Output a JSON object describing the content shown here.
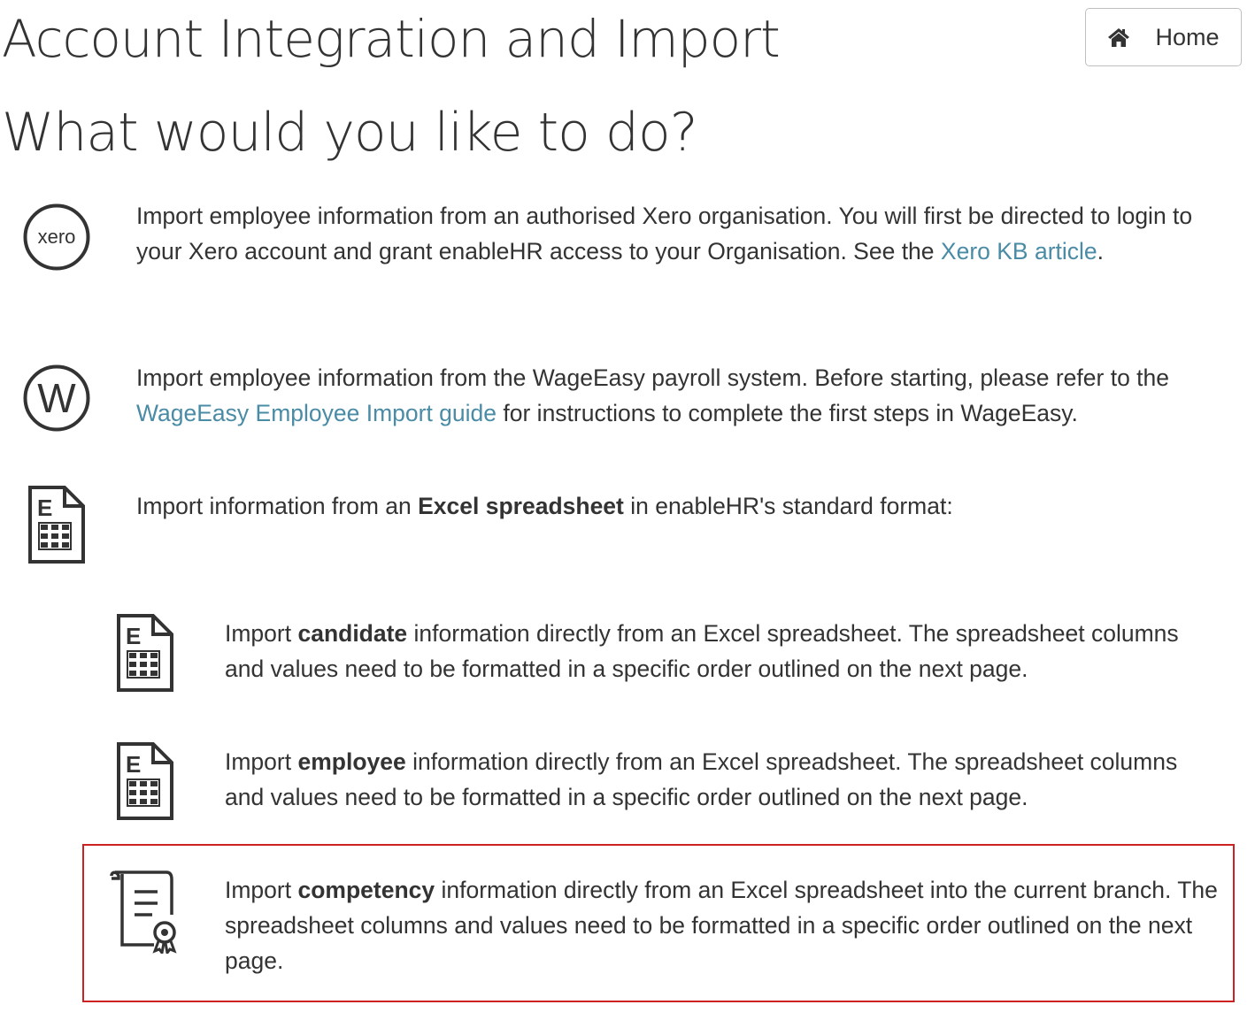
{
  "header": {
    "title": "Account Integration and Import",
    "home_button": {
      "label": "Home",
      "icon": "home-icon"
    }
  },
  "section_title": "What would you like to do?",
  "options": {
    "xero": {
      "icon": "xero-logo-icon",
      "logo_text": "xero",
      "text_1": "Import employee information from an authorised Xero organisation. You will first be directed to login to your Xero account and grant enableHR access to your Organisation. See the ",
      "link": "Xero KB article",
      "text_2": "."
    },
    "wageeasy": {
      "icon": "wageeasy-logo-icon",
      "logo_text": "W",
      "text_1": "Import employee information from the WageEasy payroll system. Before starting, please refer to the ",
      "link": "WageEasy Employee Import guide",
      "text_2": " for instructions to complete the first steps in WageEasy."
    },
    "excel": {
      "icon": "excel-spreadsheet-icon",
      "text_1": "Import information from an ",
      "bold": "Excel spreadsheet",
      "text_2": " in enableHR's standard format:"
    },
    "candidate": {
      "icon": "excel-spreadsheet-icon",
      "text_1": "Import ",
      "bold": "candidate",
      "text_2": " information directly from an Excel spreadsheet. The spreadsheet columns and values need to be formatted in a specific order outlined on the next page."
    },
    "employee": {
      "icon": "excel-spreadsheet-icon",
      "text_1": "Import ",
      "bold": "employee",
      "text_2": " information directly from an Excel spreadsheet. The spreadsheet columns and values need to be formatted in a specific order outlined on the next page."
    },
    "competency": {
      "icon": "certificate-scroll-icon",
      "text_1": "Import ",
      "bold": "competency",
      "text_2": " information directly from an Excel spreadsheet into the current branch. The spreadsheet columns and values need to be formatted in a specific order outlined on the next page.",
      "highlighted": true
    }
  },
  "colors": {
    "text": "#333333",
    "link": "#4a8ba6",
    "highlight_border": "#cc2222",
    "button_border": "#bfbfbf"
  }
}
